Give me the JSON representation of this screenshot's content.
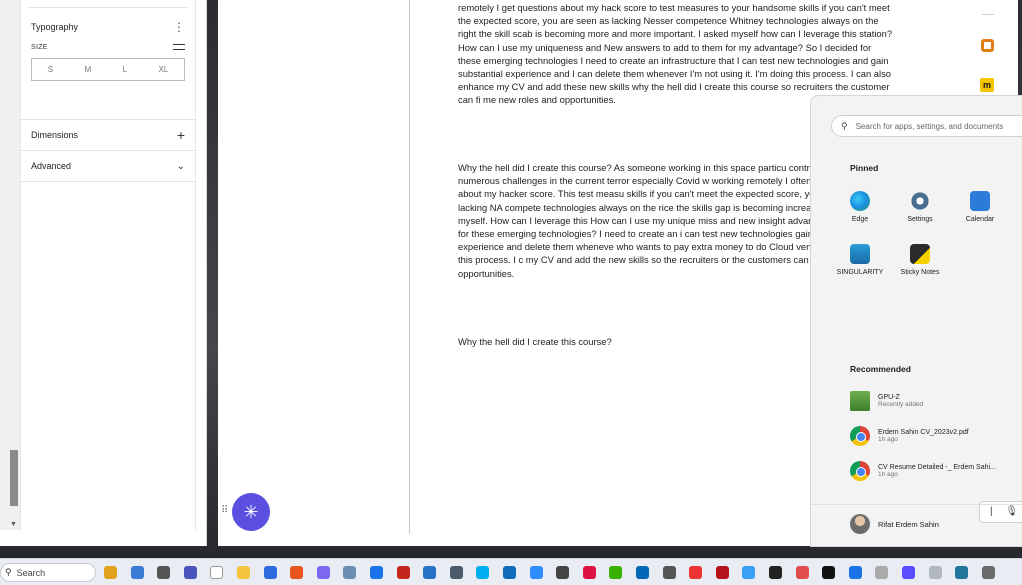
{
  "left_panel": {
    "typography": {
      "title": "Typography",
      "menu_icon": "kebab-icon",
      "size_label": "SIZE",
      "sizes": [
        "S",
        "M",
        "L",
        "XL"
      ]
    },
    "dimensions": {
      "title": "Dimensions"
    },
    "advanced": {
      "title": "Advanced"
    }
  },
  "document": {
    "paragraphs": [
      "remotely I get questions about my hack score to test measures to your handsome skills if you can't meet the expected score, you are seen as lacking Nesser competence Whitney technologies always on the right the skill scab is becoming more and more important. I asked myself how can I leverage this station? How can I use my uniqueness and New answers to add to them for my advantage? So I decided for these emerging technologies I need to create an infrastructure that I can test new technologies and gain substantial experience and I can delete them whenever I'm not using it. I'm doing this process. I can also enhance my CV and add these new skills why the hell did I create this course so recruiters the customer can fi me new roles and opportunities.",
      "Why the hell did I create this course? As someone working in this space particu contractor? I faced numerous challenges in the current terror especially Covid w working remotely I often get questions about my hacker score. This test measu skills if you can't meet the expected score, you are seen as lacking NA compete technologies always on the rice the skills gap is becoming increasing the impor myself. How can I leverage this How can I use my unique miss and new insight advantage? So I decided for these emerging technologies? I need to create an i can test new technologies gain substantial experience and delete them wheneve who wants to pay extra money to do Cloud vendors throughout this process. I c my CV and add the new skills so the recruiters or the customers can find me ot opportunities.",
      "Why the hell did I create this course?"
    ]
  },
  "start_menu": {
    "search_placeholder": "Search for apps, settings, and documents",
    "pinned_heading": "Pinned",
    "pinned": [
      {
        "label": "Edge",
        "icon": "edge-icon"
      },
      {
        "label": "Settings",
        "icon": "settings-icon"
      },
      {
        "label": "Calendar",
        "icon": "calendar-icon"
      },
      {
        "label": "SINGULARITY",
        "icon": "singularity-icon"
      },
      {
        "label": "Sticky Notes",
        "icon": "sticky-notes-icon"
      }
    ],
    "recommended_heading": "Recommended",
    "recommended": [
      {
        "name": "GPU-Z",
        "time": "Recently added",
        "icon": "gpu-z-icon"
      },
      {
        "name": "Erdem Sahin CV_2023v2.pdf",
        "time": "1h ago",
        "icon": "chrome-icon"
      },
      {
        "name": "CV Resume Detailed -_ Erdem Sahi...",
        "time": "1h ago",
        "icon": "chrome-icon"
      }
    ],
    "user_name": "Rifat Erdem Sahin"
  },
  "taskbar": {
    "search_label": "Search",
    "icons": [
      "briefcase-icon",
      "widgets-icon",
      "terminal-icon",
      "teams-icon",
      "file-icon",
      "folder-icon",
      "app-icon",
      "presentation-icon",
      "app-icon",
      "photos-icon",
      "chrome-icon",
      "pdf-icon",
      "store-icon",
      "settings-icon",
      "skype-icon",
      "outlook-icon",
      "zoom-icon",
      "game-icon",
      "app-icon",
      "app-icon",
      "app-icon",
      "app-icon",
      "app-icon",
      "filezilla-icon",
      "app-icon",
      "app-icon",
      "app-icon",
      "app-icon",
      "app-icon",
      "app-icon",
      "app-icon",
      "app-icon",
      "app-icon",
      "wordpress-icon"
    ]
  }
}
